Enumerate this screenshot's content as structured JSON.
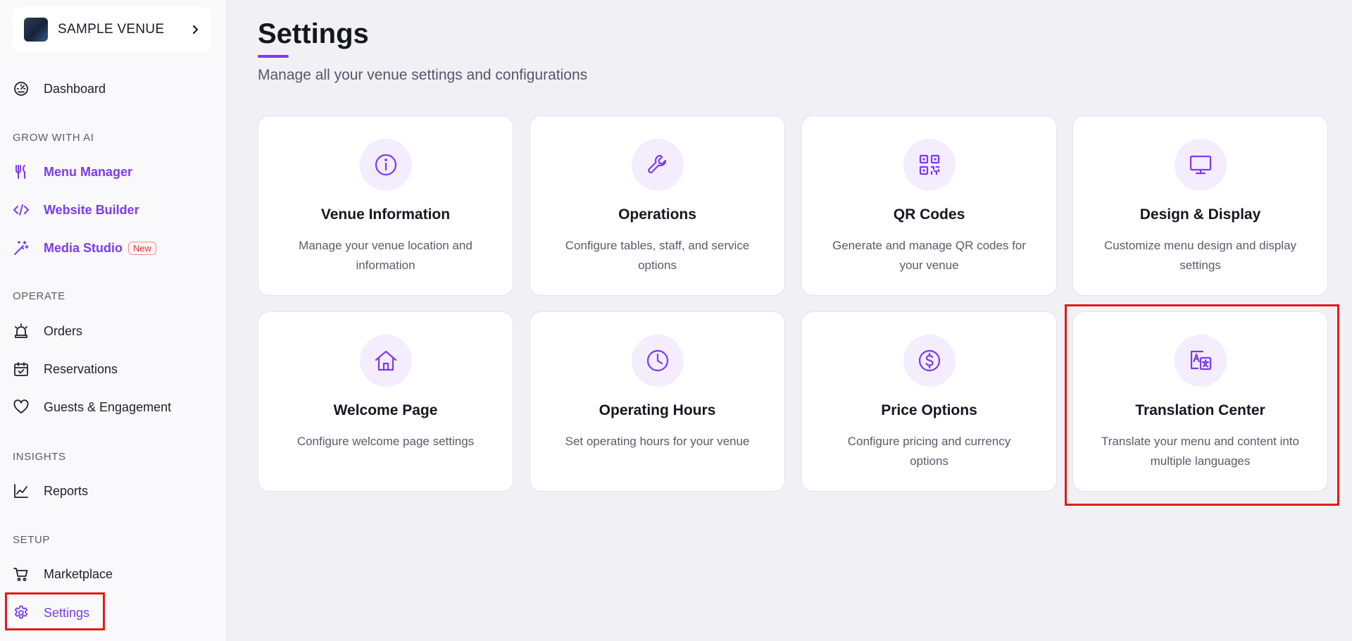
{
  "venue": {
    "name": "SAMPLE VENUE"
  },
  "nav": {
    "dashboard": "Dashboard",
    "section_grow": "GROW WITH AI",
    "menu_manager": "Menu Manager",
    "website_builder": "Website Builder",
    "media_studio": "Media Studio",
    "media_studio_badge": "New",
    "section_operate": "OPERATE",
    "orders": "Orders",
    "reservations": "Reservations",
    "guests": "Guests & Engagement",
    "section_insights": "INSIGHTS",
    "reports": "Reports",
    "section_setup": "SETUP",
    "marketplace": "Marketplace",
    "settings": "Settings"
  },
  "page": {
    "title": "Settings",
    "subtitle": "Manage all your venue settings and configurations"
  },
  "cards": [
    {
      "icon": "info-icon",
      "title": "Venue Information",
      "desc": "Manage your venue location and information"
    },
    {
      "icon": "wrench-icon",
      "title": "Operations",
      "desc": "Configure tables, staff, and service options"
    },
    {
      "icon": "qr-code-icon",
      "title": "QR Codes",
      "desc": "Generate and manage QR codes for your venue"
    },
    {
      "icon": "monitor-icon",
      "title": "Design & Display",
      "desc": "Customize menu design and display settings"
    },
    {
      "icon": "home-icon",
      "title": "Welcome Page",
      "desc": "Configure welcome page settings"
    },
    {
      "icon": "clock-icon",
      "title": "Operating Hours",
      "desc": "Set operating hours for your venue"
    },
    {
      "icon": "dollar-icon",
      "title": "Price Options",
      "desc": "Configure pricing and currency options"
    },
    {
      "icon": "translate-icon",
      "title": "Translation Center",
      "desc": "Translate your menu and content into multiple languages"
    }
  ],
  "colors": {
    "accent": "#7c3aed",
    "highlight": "#e01b1b",
    "background": "#f1f1f5"
  }
}
